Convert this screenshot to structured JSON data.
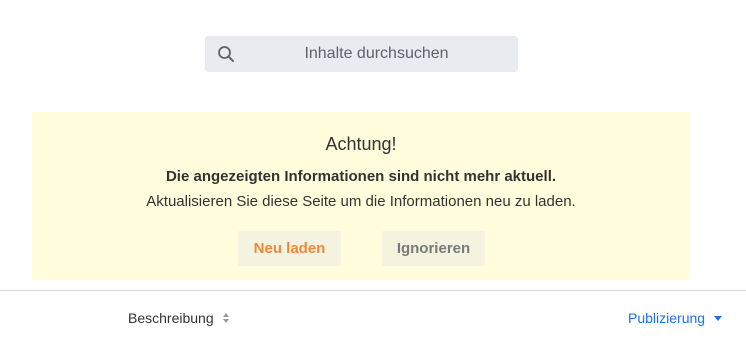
{
  "search": {
    "placeholder": "Inhalte durchsuchen",
    "icon": "search-icon"
  },
  "banner": {
    "title": "Achtung!",
    "subtitle": "Die angezeigten Informationen sind nicht mehr aktuell.",
    "message": "Aktualisieren Sie diese Seite um die Informationen neu zu laden.",
    "reload_label": "Neu laden",
    "ignore_label": "Ignorieren",
    "background": "#fffddb"
  },
  "columns": {
    "description_label": "Beschreibung",
    "description_sort_icon": "sort-both-icon",
    "publication_label": "Publizierung",
    "publication_sort_icon": "sort-down-icon",
    "active_color": "#1a73e8"
  },
  "colors": {
    "reload": "#f0883a",
    "ignore": "#7a7a7a"
  }
}
